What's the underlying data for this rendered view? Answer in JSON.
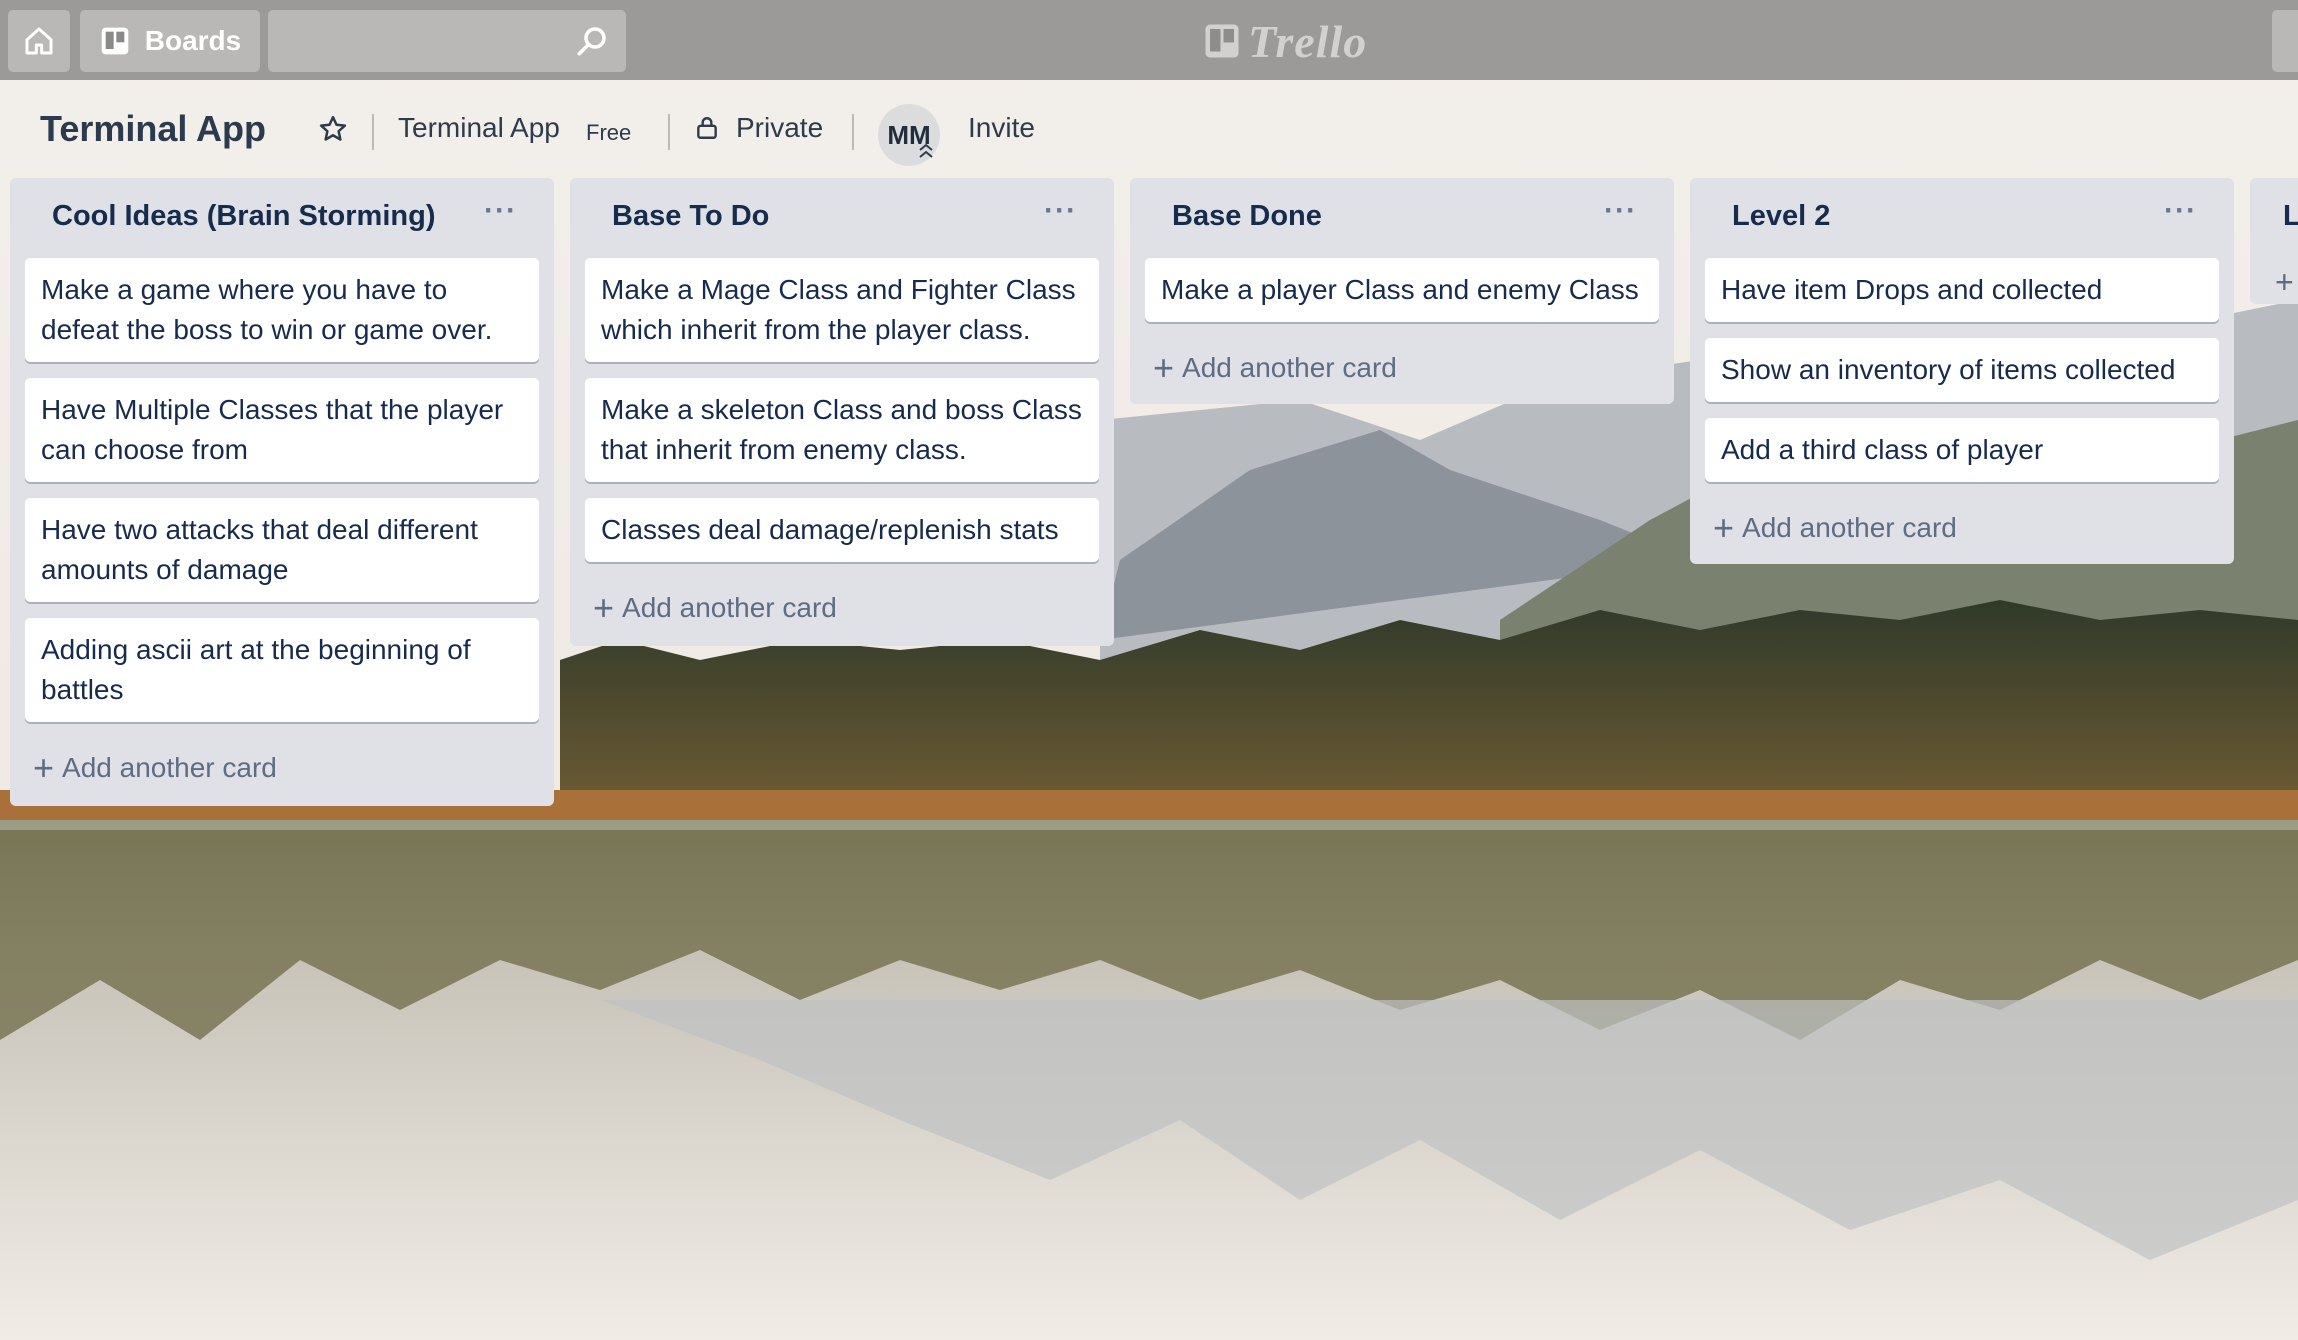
{
  "header": {
    "boards_label": "Boards",
    "search_value": "",
    "logo_text": "Trello"
  },
  "board": {
    "title": "Terminal App",
    "team_name": "Terminal App",
    "plan": "Free",
    "visibility": "Private",
    "member_initials": "MM",
    "invite_label": "Invite"
  },
  "lists": [
    {
      "title": "Cool Ideas (Brain Storming)",
      "menu": "···",
      "cards": [
        "Make a game where you have to defeat the boss to win or game over.",
        "Have Multiple Classes that the player can choose from",
        "Have two attacks that deal different amounts of damage",
        "Adding ascii art at the beginning of battles"
      ],
      "add_label": "Add another card"
    },
    {
      "title": "Base To Do",
      "menu": "···",
      "cards": [
        "Make a Mage Class and Fighter Class which inherit from the player class.",
        "Make a skeleton Class and boss Class that inherit from enemy class.",
        "Classes deal damage/replenish stats"
      ],
      "add_label": "Add another card"
    },
    {
      "title": "Base Done",
      "menu": "···",
      "cards": [
        "Make a player Class and enemy Class"
      ],
      "add_label": "Add another card"
    },
    {
      "title": "Level 2",
      "menu": "···",
      "cards": [
        "Have item Drops and collected",
        "Show an inventory of items collected",
        "Add a third class of player"
      ],
      "add_label": "Add another card"
    }
  ],
  "peek_list": {
    "title_fragment": "L"
  },
  "colors": {
    "header_bg": "#787878",
    "list_bg": "#dfe1e6",
    "card_text": "#172b4d"
  }
}
